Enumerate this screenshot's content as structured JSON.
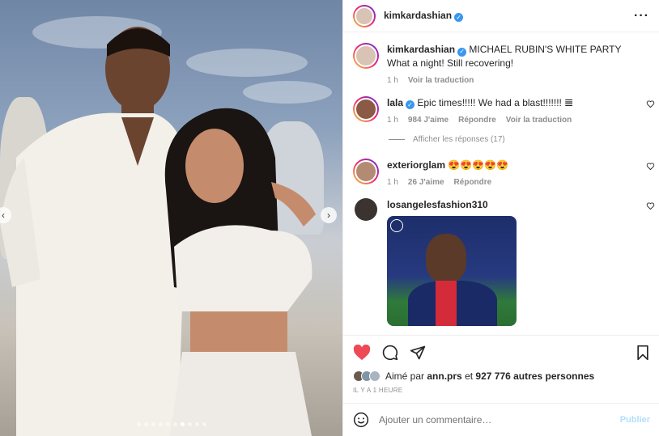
{
  "post": {
    "username": "kimkardashian",
    "more_icon": "more-icon",
    "carousel": {
      "total_slides": 10,
      "active_index": 6
    }
  },
  "caption": {
    "username": "kimkardashian",
    "text": "MICHAEL RUBIN'S WHITE PARTY What a night! Still recovering!",
    "time": "1 h",
    "translate": "Voir la traduction"
  },
  "comments": [
    {
      "username": "lala",
      "text": "Epic times!!!!! We had a blast!!!!!!! 𝌆",
      "time": "1 h",
      "likes": "984 J'aime",
      "reply": "Répondre",
      "translate": "Voir la traduction",
      "replies_label": "Afficher les réponses (17)"
    },
    {
      "username": "exteriorglam",
      "text": "😍😍😍😍😍",
      "time": "1 h",
      "likes": "26 J'aime",
      "reply": "Répondre"
    },
    {
      "username": "losangelesfashion310",
      "has_gif": true
    }
  ],
  "likes_text": {
    "prefix": "Aimé par",
    "user": "ann.prs",
    "middle": "et",
    "count": "927 776 autres personnes"
  },
  "timestamp": "IL Y A 1 HEURE",
  "add_comment": {
    "placeholder": "Ajouter un commentaire…",
    "publish": "Publier"
  },
  "colors": {
    "like_red": "#ed4956",
    "verified_blue": "#3897f0",
    "publish_disabled": "#b2dffc"
  }
}
